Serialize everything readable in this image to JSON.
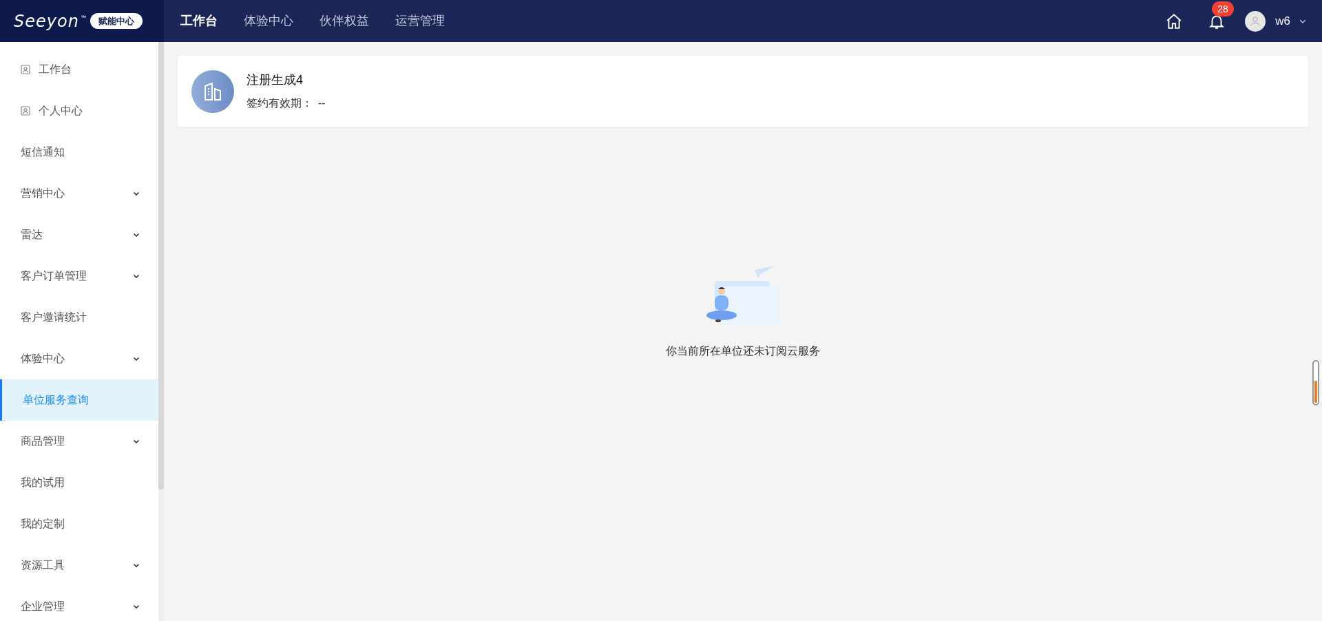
{
  "header": {
    "logo_text": "Seeyon",
    "logo_mark": "™",
    "badge": "赋能中心",
    "nav": [
      {
        "label": "工作台",
        "selected": true
      },
      {
        "label": "体验中心",
        "selected": false
      },
      {
        "label": "伙伴权益",
        "selected": false
      },
      {
        "label": "运营管理",
        "selected": false
      }
    ],
    "notification_count": "28",
    "user": "w6"
  },
  "sidebar": {
    "items": [
      {
        "label": "工作台",
        "kind": "icon",
        "selected": false
      },
      {
        "label": "个人中心",
        "kind": "icon",
        "selected": false
      },
      {
        "label": "短信通知",
        "kind": "plain",
        "selected": false
      },
      {
        "label": "营销中心",
        "kind": "group",
        "selected": false
      },
      {
        "label": "雷达",
        "kind": "group",
        "selected": false
      },
      {
        "label": "客户订单管理",
        "kind": "group",
        "selected": false
      },
      {
        "label": "客户邀请统计",
        "kind": "plain",
        "selected": false
      },
      {
        "label": "体验中心",
        "kind": "group",
        "selected": false
      },
      {
        "label": "单位服务查询",
        "kind": "plain",
        "selected": true
      },
      {
        "label": "商品管理",
        "kind": "group",
        "selected": false
      },
      {
        "label": "我的试用",
        "kind": "plain",
        "selected": false
      },
      {
        "label": "我的定制",
        "kind": "plain",
        "selected": false
      },
      {
        "label": "资源工具",
        "kind": "group",
        "selected": false
      },
      {
        "label": "企业管理",
        "kind": "group",
        "selected": false
      }
    ]
  },
  "company_card": {
    "name": "注册生成4",
    "label": "签约有效期：",
    "value": "--"
  },
  "empty_state": {
    "message": "你当前所在单位还未订阅云服务"
  }
}
